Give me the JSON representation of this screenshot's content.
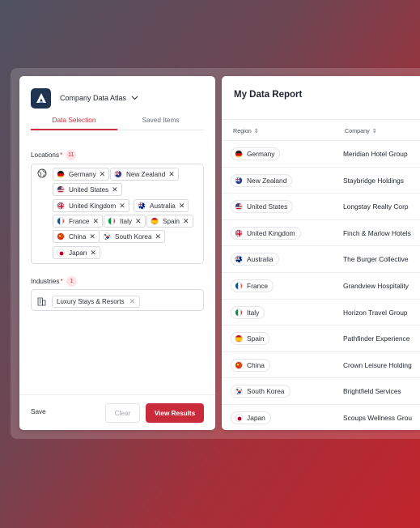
{
  "app": {
    "name": "Company Data Atlas"
  },
  "tabs": [
    {
      "label": "Data Selection",
      "active": true
    },
    {
      "label": "Saved Items",
      "active": false
    }
  ],
  "locations": {
    "label": "Locations",
    "required_mark": "*",
    "count": "11",
    "chips": [
      {
        "label": "Germany",
        "flag": "germany"
      },
      {
        "label": "New Zealand",
        "flag": "new-zealand"
      },
      {
        "label": "United States",
        "flag": "united-states"
      },
      {
        "label": "United Kingdom",
        "flag": "united-kingdom"
      },
      {
        "label": "Australia",
        "flag": "australia"
      },
      {
        "label": "France",
        "flag": "france"
      },
      {
        "label": "Italy",
        "flag": "italy"
      },
      {
        "label": "Spain",
        "flag": "spain"
      },
      {
        "label": "China",
        "flag": "china"
      },
      {
        "label": "South Korea",
        "flag": "south-korea"
      },
      {
        "label": "Japan",
        "flag": "japan"
      }
    ],
    "remove_glyph": "✕"
  },
  "industries": {
    "label": "Industries",
    "required_mark": "*",
    "count": "1",
    "chips": [
      {
        "label": "Luxury Stays & Resorts"
      }
    ],
    "remove_glyph": "✕"
  },
  "footer": {
    "save_label": "Save",
    "clear_label": "Clear",
    "view_label": "View Results"
  },
  "report": {
    "title": "My Data Report",
    "columns": [
      {
        "label": "Region",
        "sort": "⇕"
      },
      {
        "label": "Company",
        "sort": "⇕"
      }
    ],
    "rows": [
      {
        "region": "Germany",
        "flag": "germany",
        "company": "Meridian Hotel Group"
      },
      {
        "region": "New Zealand",
        "flag": "new-zealand",
        "company": "Staybridge Holdings"
      },
      {
        "region": "United States",
        "flag": "united-states",
        "company": "Longstay Realty Corp"
      },
      {
        "region": "United Kingdom",
        "flag": "united-kingdom",
        "company": "Finch & Marlow Hotels"
      },
      {
        "region": "Australia",
        "flag": "australia",
        "company": "The Burger Collective"
      },
      {
        "region": "France",
        "flag": "france",
        "company": "Grandview Hospitality"
      },
      {
        "region": "Italy",
        "flag": "italy",
        "company": "Horizon Travel Group"
      },
      {
        "region": "Spain",
        "flag": "spain",
        "company": "Pathfinder Experience"
      },
      {
        "region": "China",
        "flag": "china",
        "company": "Crown Leisure Holding"
      },
      {
        "region": "South Korea",
        "flag": "south-korea",
        "company": "Brightfield Services"
      },
      {
        "region": "Japan",
        "flag": "japan",
        "company": "Scoups Wellness Grou"
      }
    ]
  },
  "colors": {
    "accent": "#c92b3b",
    "logo_bg": "#1f3452"
  }
}
